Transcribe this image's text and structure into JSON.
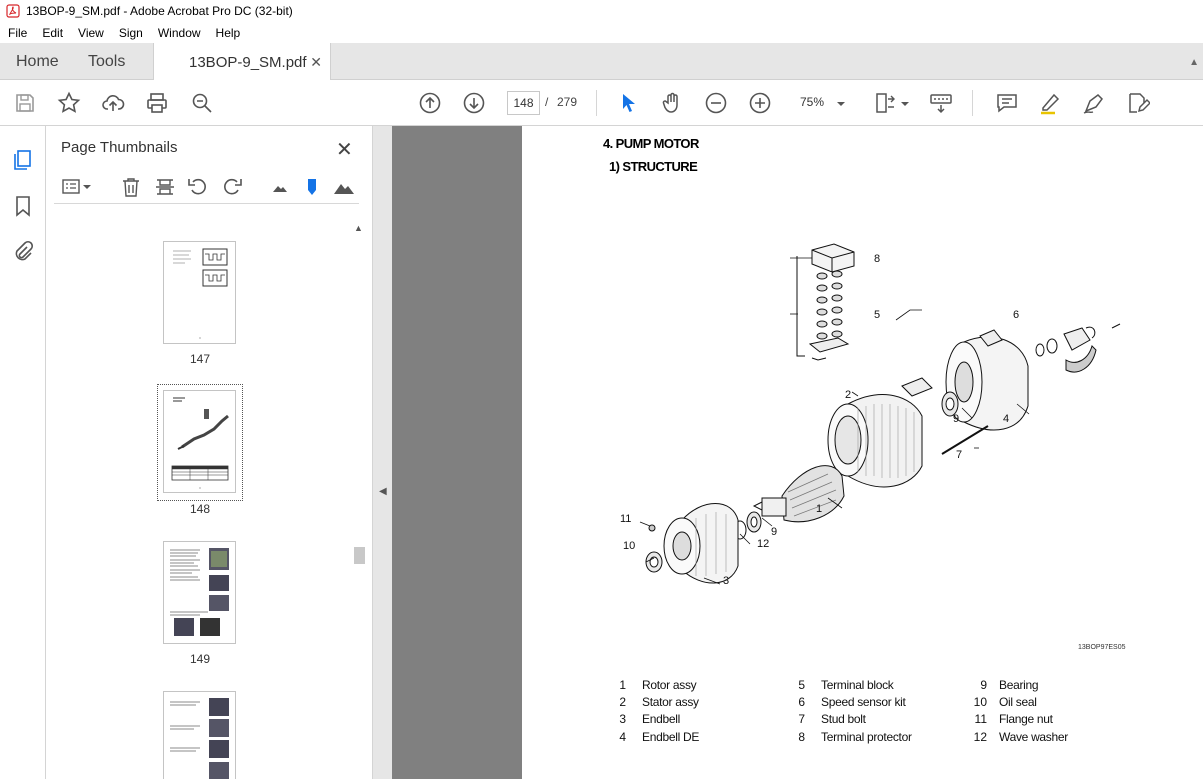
{
  "window": {
    "title": "13BOP-9_SM.pdf - Adobe Acrobat Pro DC (32-bit)"
  },
  "menu": [
    "File",
    "Edit",
    "View",
    "Sign",
    "Window",
    "Help"
  ],
  "tabs": {
    "home": "Home",
    "tools": "Tools",
    "document": "13BOP-9_SM.pdf"
  },
  "toolbar": {
    "page_current": "148",
    "page_sep": "/",
    "page_total": "279",
    "zoom": "75%"
  },
  "panel": {
    "title": "Page Thumbnails",
    "thumbnails": [
      {
        "label": "147"
      },
      {
        "label": "148",
        "selected": true
      },
      {
        "label": "149"
      },
      {
        "label": ""
      }
    ]
  },
  "document": {
    "heading": "4. PUMP MOTOR",
    "subheading": "1) STRUCTURE",
    "drawing_id": "13BOP97ES05",
    "callouts": [
      "8",
      "5",
      "6",
      "2",
      "9",
      "4",
      "7",
      "1",
      "11",
      "9",
      "10",
      "12",
      "3"
    ],
    "legend": [
      {
        "num": "1",
        "label": "Rotor assy"
      },
      {
        "num": "2",
        "label": "Stator assy"
      },
      {
        "num": "3",
        "label": "Endbell"
      },
      {
        "num": "4",
        "label": "Endbell DE"
      },
      {
        "num": "5",
        "label": "Terminal block"
      },
      {
        "num": "6",
        "label": "Speed sensor kit"
      },
      {
        "num": "7",
        "label": "Stud bolt"
      },
      {
        "num": "8",
        "label": "Terminal protector"
      },
      {
        "num": "9",
        "label": "Bearing"
      },
      {
        "num": "10",
        "label": "Oil seal"
      },
      {
        "num": "11",
        "label": "Flange nut"
      },
      {
        "num": "12",
        "label": "Wave washer"
      }
    ]
  },
  "colors": {
    "accent_blue": "#1473e6",
    "pdf_red": "#d7262a",
    "doc_bg": "#808080"
  }
}
